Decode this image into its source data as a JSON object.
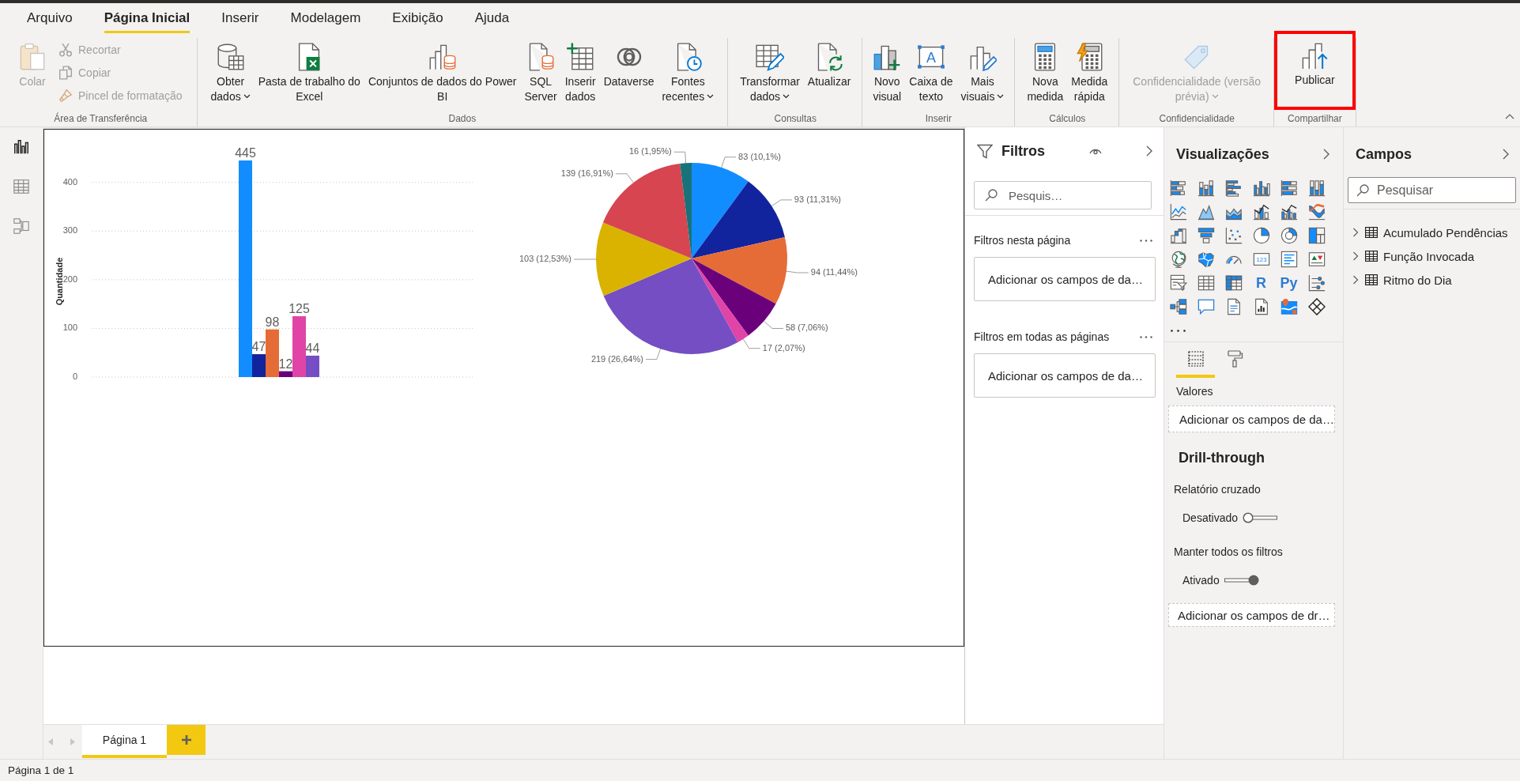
{
  "menu_tabs": [
    {
      "label": "Arquivo",
      "selected": false
    },
    {
      "label": "Página Inicial",
      "selected": true
    },
    {
      "label": "Inserir",
      "selected": false
    },
    {
      "label": "Modelagem",
      "selected": false
    },
    {
      "label": "Exibição",
      "selected": false
    },
    {
      "label": "Ajuda",
      "selected": false
    }
  ],
  "ribbon": {
    "groups": [
      {
        "label": "Área de Transferência",
        "buttons": [
          {
            "kind": "large",
            "label": "Colar",
            "disabled": true,
            "dropdown": false,
            "highlighted": false
          },
          {
            "kind": "small",
            "label": "Recortar",
            "disabled": true,
            "dropdown": false,
            "highlighted": false
          },
          {
            "kind": "small",
            "label": "Copiar",
            "disabled": true,
            "dropdown": false,
            "highlighted": false
          },
          {
            "kind": "small",
            "label": "Pincel de formatação",
            "disabled": true,
            "dropdown": false,
            "highlighted": false
          }
        ]
      },
      {
        "label": "Dados",
        "buttons": [
          {
            "kind": "large",
            "label": "Obter\ndados",
            "disabled": false,
            "dropdown": true,
            "highlighted": false
          },
          {
            "kind": "large",
            "label": "Pasta de trabalho do\nExcel",
            "disabled": false,
            "dropdown": false,
            "highlighted": false
          },
          {
            "kind": "large",
            "label": "Conjuntos de dados do Power\nBI",
            "disabled": false,
            "dropdown": false,
            "highlighted": false
          },
          {
            "kind": "large",
            "label": "SQL\nServer",
            "disabled": false,
            "dropdown": false,
            "highlighted": false
          },
          {
            "kind": "large",
            "label": "Inserir\ndados",
            "disabled": false,
            "dropdown": false,
            "highlighted": false
          },
          {
            "kind": "large",
            "label": "Dataverse",
            "disabled": false,
            "dropdown": false,
            "highlighted": false
          },
          {
            "kind": "large",
            "label": "Fontes\nrecentes",
            "disabled": false,
            "dropdown": true,
            "highlighted": false
          }
        ]
      },
      {
        "label": "Consultas",
        "buttons": [
          {
            "kind": "large",
            "label": "Transformar\ndados",
            "disabled": false,
            "dropdown": true,
            "highlighted": false
          },
          {
            "kind": "large",
            "label": "Atualizar",
            "disabled": false,
            "dropdown": false,
            "highlighted": false
          }
        ]
      },
      {
        "label": "Inserir",
        "buttons": [
          {
            "kind": "large",
            "label": "Novo\nvisual",
            "disabled": false,
            "dropdown": false,
            "highlighted": false
          },
          {
            "kind": "large",
            "label": "Caixa de\ntexto",
            "icon_label": "A",
            "disabled": false,
            "dropdown": false,
            "highlighted": false
          },
          {
            "kind": "large",
            "label": "Mais\nvisuais",
            "disabled": false,
            "dropdown": true,
            "highlighted": false
          }
        ]
      },
      {
        "label": "Cálculos",
        "buttons": [
          {
            "kind": "large",
            "label": "Nova\nmedida",
            "disabled": false,
            "dropdown": false,
            "highlighted": false
          },
          {
            "kind": "large",
            "label": "Medida\nrápida",
            "disabled": false,
            "dropdown": false,
            "highlighted": false
          }
        ]
      },
      {
        "label": "Confidencialidade",
        "buttons": [
          {
            "kind": "large",
            "label": "Confidencialidade (versão\nprévia)",
            "disabled": true,
            "dropdown": true,
            "highlighted": false
          }
        ]
      },
      {
        "label": "Compartilhar",
        "buttons": [
          {
            "kind": "large",
            "label": "Publicar",
            "disabled": false,
            "dropdown": false,
            "highlighted": true
          }
        ]
      }
    ]
  },
  "left_nav": {
    "views": [
      {
        "selected": true
      },
      {
        "selected": false
      },
      {
        "selected": false
      }
    ]
  },
  "report_page": {
    "column_chart": {
      "chart_data": {
        "type": "bar",
        "ylabel": "Quantidade",
        "ylim": [
          0,
          445
        ],
        "yticks": [
          0,
          100,
          200,
          300,
          400
        ],
        "grid": true,
        "series": [
          {
            "color": "#118dff",
            "values": [
              445
            ]
          },
          {
            "color": "#12239e",
            "values": [
              47
            ]
          },
          {
            "color": "#e66c37",
            "values": [
              98
            ]
          },
          {
            "color": "#6b007b",
            "values": [
              12
            ]
          },
          {
            "color": "#e044a7",
            "values": [
              125
            ]
          },
          {
            "color": "#744ec2",
            "values": [
              44
            ]
          }
        ],
        "value_labels": [
          "445",
          "47",
          "98",
          "12",
          "125",
          "44"
        ]
      }
    },
    "pie_chart": {
      "chart_data": {
        "type": "pie",
        "values": [
          83,
          93,
          94,
          58,
          17,
          219,
          103,
          139,
          16
        ],
        "colors": [
          "#118dff",
          "#12239e",
          "#e66c37",
          "#6b007b",
          "#e044a7",
          "#744ec2",
          "#d9b300",
          "#d64550",
          "#197278"
        ],
        "value_labels": [
          "83 (10,1%)",
          "93 (11,31%)",
          "94 (11,44%)",
          "58 (7,06%)",
          "17 (2,07%)",
          "219 (26,64%)",
          "103 (12,53%)",
          "139 (16,91%)",
          "16 (1,95%)"
        ]
      }
    }
  },
  "filters_pane": {
    "title": "Filtros",
    "search": {
      "placeholder": "Pesquis…"
    },
    "sections": [
      {
        "title": "Filtros nesta página",
        "drop_hint": "Adicionar os campos de da…"
      },
      {
        "title": "Filtros em todas as páginas",
        "drop_hint": "Adicionar os campos de da…"
      }
    ]
  },
  "visualizations_pane": {
    "title": "Visualizações",
    "gallery": [
      {
        "kind": "icon"
      },
      {
        "kind": "icon"
      },
      {
        "kind": "icon"
      },
      {
        "kind": "icon"
      },
      {
        "kind": "icon"
      },
      {
        "kind": "icon"
      },
      {
        "kind": "icon"
      },
      {
        "kind": "icon"
      },
      {
        "kind": "icon"
      },
      {
        "kind": "icon"
      },
      {
        "kind": "icon"
      },
      {
        "kind": "icon"
      },
      {
        "kind": "icon"
      },
      {
        "kind": "icon"
      },
      {
        "kind": "icon"
      },
      {
        "kind": "icon"
      },
      {
        "kind": "icon"
      },
      {
        "kind": "icon"
      },
      {
        "kind": "icon"
      },
      {
        "kind": "icon"
      },
      {
        "kind": "icon"
      },
      {
        "kind": "card",
        "label": "123"
      },
      {
        "kind": "icon"
      },
      {
        "kind": "icon"
      },
      {
        "kind": "icon"
      },
      {
        "kind": "icon"
      },
      {
        "kind": "icon"
      },
      {
        "kind": "text",
        "label": "R"
      },
      {
        "kind": "text",
        "label": "Py"
      },
      {
        "kind": "icon"
      },
      {
        "kind": "icon"
      },
      {
        "kind": "icon"
      },
      {
        "kind": "icon"
      },
      {
        "kind": "icon"
      },
      {
        "kind": "icon"
      },
      {
        "kind": "icon"
      }
    ],
    "pane_tabs": [
      {
        "selected": true
      },
      {
        "selected": false
      }
    ],
    "well": {
      "label": "Valores",
      "drop_hint": "Adicionar os campos de da…"
    },
    "drill_through": {
      "title": "Drill-through",
      "options": [
        {
          "label": "Relatório cruzado",
          "state_label": "Desativado",
          "on": false
        },
        {
          "label": "Manter todos os filtros",
          "state_label": "Ativado",
          "on": true
        }
      ],
      "drop_hint": "Adicionar os campos de dr…"
    }
  },
  "fields_pane": {
    "title": "Campos",
    "search": {
      "placeholder": "Pesquisar"
    },
    "tables": [
      {
        "name": "Acumulado Pendências",
        "expanded": false
      },
      {
        "name": "Função Invocada",
        "expanded": false
      },
      {
        "name": "Ritmo do Dia",
        "expanded": false
      }
    ]
  },
  "page_tabs": [
    {
      "label": "Página 1",
      "selected": true
    }
  ],
  "status_bar": {
    "text": "Página 1 de 1"
  }
}
